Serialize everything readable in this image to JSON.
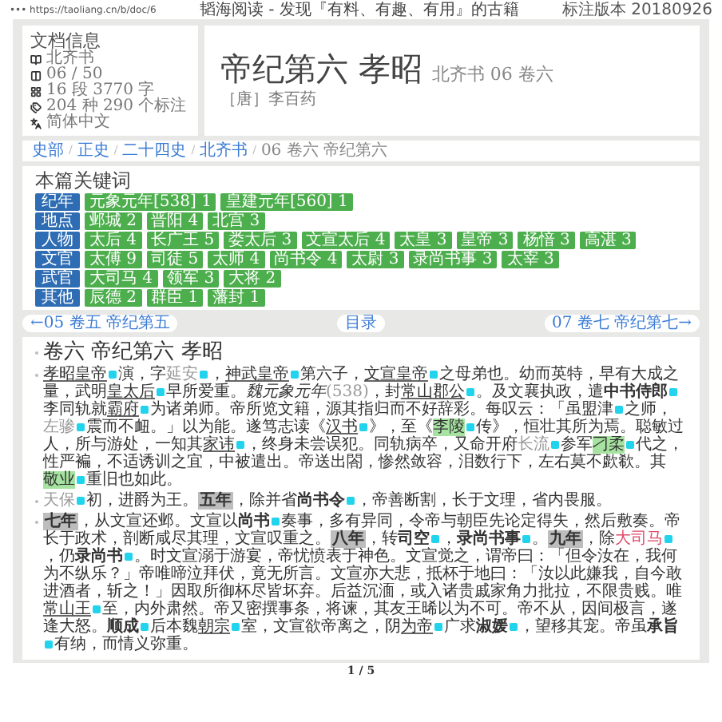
{
  "browser_bar": {
    "url": "••• https://taoliang.cn/b/doc/6",
    "page_title": "韬海阅读 - 发现『有料、有趣、有用』的古籍",
    "version": "标注版本 20180926"
  },
  "doc_info": {
    "title": "文档信息",
    "items": [
      {
        "kind": "book",
        "text": "北齐书"
      },
      {
        "kind": "chapter",
        "text": "06 / 50"
      },
      {
        "kind": "length",
        "text": "16 段 3770 字"
      },
      {
        "kind": "tags",
        "text": "204 种 290 个标注"
      },
      {
        "kind": "language",
        "text": "简体中文"
      }
    ]
  },
  "heading": {
    "title": "帝纪第六 孝昭",
    "subtitle": "北齐书 06 卷六",
    "author": "［唐］李百药"
  },
  "breadcrumb": {
    "separator": "/",
    "items": [
      "史部",
      "正史",
      "二十四史",
      "北齐书",
      "06 卷六 帝纪第六"
    ]
  },
  "keywords": {
    "title": "本篇关键词",
    "groups": [
      {
        "category": "纪年",
        "tags": [
          "元象元年[538] 1",
          "皇建元年[560] 1"
        ]
      },
      {
        "category": "地点",
        "tags": [
          "邺城 2",
          "晋阳 4",
          "北宫 3"
        ]
      },
      {
        "category": "人物",
        "tags": [
          "太后 4",
          "长广王 5",
          "娄太后 3",
          "文宣太后 4",
          "太皇 3",
          "皇帝 3",
          "杨愔 3",
          "高湛 3"
        ]
      },
      {
        "category": "文官",
        "tags": [
          "太傅 9",
          "司徒 5",
          "太师 4",
          "尚书令 4",
          "太尉 3",
          "录尚书事 3",
          "太宰 3"
        ]
      },
      {
        "category": "武官",
        "tags": [
          "大司马 4",
          "领军 3",
          "大将 2"
        ]
      },
      {
        "category": "其他",
        "tags": [
          "辰德 2",
          "群臣 1",
          "藩封 1"
        ]
      }
    ]
  },
  "nav": {
    "prev": "←05 卷五 帝纪第五",
    "toc": "目录",
    "next": "07 卷七 帝纪第七→"
  },
  "chapter": {
    "title": "卷六 帝纪第六 孝昭",
    "paragraphs": [
      [
        {
          "kind": "person",
          "text": "孝昭皇帝"
        },
        {
          "kind": "note"
        },
        {
          "kind": "plain",
          "text": "演，字"
        },
        {
          "kind": "minor",
          "text": "延安"
        },
        {
          "kind": "note"
        },
        {
          "kind": "plain",
          "text": "，"
        },
        {
          "kind": "person",
          "text": "神武皇帝"
        },
        {
          "kind": "note"
        },
        {
          "kind": "plain",
          "text": "第六子，"
        },
        {
          "kind": "person",
          "text": "文宣皇帝"
        },
        {
          "kind": "note"
        },
        {
          "kind": "plain",
          "text": "之母弟也。幼而英特，早有大成之量，武明"
        },
        {
          "kind": "person",
          "text": "皇太后"
        },
        {
          "kind": "note"
        },
        {
          "kind": "plain",
          "text": "早所爱重。"
        },
        {
          "kind": "era",
          "text": "魏元象元年"
        },
        {
          "kind": "minor",
          "text": "(538)"
        },
        {
          "kind": "plain",
          "text": "，封"
        },
        {
          "kind": "person",
          "text": "常山郡公"
        },
        {
          "kind": "note"
        },
        {
          "kind": "plain",
          "text": "。及文襄执政，遣"
        },
        {
          "kind": "office",
          "text": "中书侍郎"
        },
        {
          "kind": "note"
        },
        {
          "kind": "plain",
          "text": "李同轨就"
        },
        {
          "kind": "person",
          "text": "霸府"
        },
        {
          "kind": "note"
        },
        {
          "kind": "plain",
          "text": "为诸弟师。帝所览文籍，源其指归而不好辞彩。每叹云：「虽盟津"
        },
        {
          "kind": "note"
        },
        {
          "kind": "plain",
          "text": "之师，"
        },
        {
          "kind": "minor",
          "text": "左骖"
        },
        {
          "kind": "note"
        },
        {
          "kind": "plain",
          "text": "震而不衄。」以为能。遂笃志读《"
        },
        {
          "kind": "person",
          "text": "汉书"
        },
        {
          "kind": "note"
        },
        {
          "kind": "plain",
          "text": "》，至《"
        },
        {
          "kind": "place",
          "text": "李陵"
        },
        {
          "kind": "note"
        },
        {
          "kind": "plain",
          "text": "传》，恒壮其所为焉。聪敏过人，所与游处，一知其"
        },
        {
          "kind": "person",
          "text": "家讳"
        },
        {
          "kind": "note"
        },
        {
          "kind": "plain",
          "text": "，终身未尝误犯。同轨病卒，又命开府"
        },
        {
          "kind": "minor",
          "text": "长流"
        },
        {
          "kind": "note"
        },
        {
          "kind": "plain",
          "text": "参军"
        },
        {
          "kind": "place",
          "text": "刁柔"
        },
        {
          "kind": "note"
        },
        {
          "kind": "plain",
          "text": "代之，性严褊，不适诱训之宜，中被遣出。帝送出閤，惨然敛容，泪数行下，左右莫不歔欷。其"
        },
        {
          "kind": "place",
          "text": "敬业"
        },
        {
          "kind": "note"
        },
        {
          "kind": "plain",
          "text": "重旧也如此。"
        }
      ],
      [
        {
          "kind": "minor",
          "text": "天保"
        },
        {
          "kind": "note"
        },
        {
          "kind": "plain",
          "text": "初，进爵为王。"
        },
        {
          "kind": "date",
          "text": "五年"
        },
        {
          "kind": "plain",
          "text": "，除并省"
        },
        {
          "kind": "office",
          "text": "尚书令"
        },
        {
          "kind": "note"
        },
        {
          "kind": "plain",
          "text": "，帝善断割，长于文理，省内畏服。"
        }
      ],
      [
        {
          "kind": "date",
          "text": "七年"
        },
        {
          "kind": "plain",
          "text": "，从文宣还邺。文宣以"
        },
        {
          "kind": "office",
          "text": "尚书"
        },
        {
          "kind": "note"
        },
        {
          "kind": "plain",
          "text": "奏事，多有异同，令帝与朝臣先论定得失，然后敷奏。帝长于政术，剖断咸尽其理，文宣叹重之。"
        },
        {
          "kind": "date",
          "text": "八年"
        },
        {
          "kind": "plain",
          "text": "，转"
        },
        {
          "kind": "office",
          "text": "司空"
        },
        {
          "kind": "note"
        },
        {
          "kind": "plain",
          "text": "，"
        },
        {
          "kind": "office",
          "text": "录尚书事"
        },
        {
          "kind": "note"
        },
        {
          "kind": "plain",
          "text": "。"
        },
        {
          "kind": "date",
          "text": "九年"
        },
        {
          "kind": "plain",
          "text": "，除"
        },
        {
          "kind": "military",
          "text": "大司马"
        },
        {
          "kind": "note"
        },
        {
          "kind": "plain",
          "text": "，仍"
        },
        {
          "kind": "office",
          "text": "录尚书"
        },
        {
          "kind": "note"
        },
        {
          "kind": "plain",
          "text": "。时文宣溺于游宴，帝忧愤表于神色。文宣觉之，谓帝曰：「但令汝在，我何为不纵乐？」帝唯啼泣拜伏，竟无所言。文宣亦大悲，抵杯于地曰：「汝以此嫌我，自今敢进酒者，斩之！」因取所御杯尽皆坏弃。后益沉湎，或入诸贵戚家角力批拉，不限贵贱。唯"
        },
        {
          "kind": "person",
          "text": "常山王"
        },
        {
          "kind": "note"
        },
        {
          "kind": "plain",
          "text": "至，内外肃然。帝又密撰事条，将谏，其友王晞以为不可。帝不从，因间极言，遂逢大怒。"
        },
        {
          "kind": "office",
          "text": "顺成"
        },
        {
          "kind": "note"
        },
        {
          "kind": "plain",
          "text": "后本魏"
        },
        {
          "kind": "person",
          "text": "朝宗"
        },
        {
          "kind": "note"
        },
        {
          "kind": "plain",
          "text": "室，文宣欲帝离之，阴"
        },
        {
          "kind": "person",
          "text": "为帝"
        },
        {
          "kind": "note"
        },
        {
          "kind": "plain",
          "text": "广求"
        },
        {
          "kind": "office",
          "text": "淑媛"
        },
        {
          "kind": "note"
        },
        {
          "kind": "plain",
          "text": "，望移其宠。帝虽"
        },
        {
          "kind": "office",
          "text": "承旨"
        },
        {
          "kind": "note"
        },
        {
          "kind": "plain",
          "text": "有纳，而情义弥重。"
        }
      ]
    ]
  },
  "pager": "1 / 5"
}
